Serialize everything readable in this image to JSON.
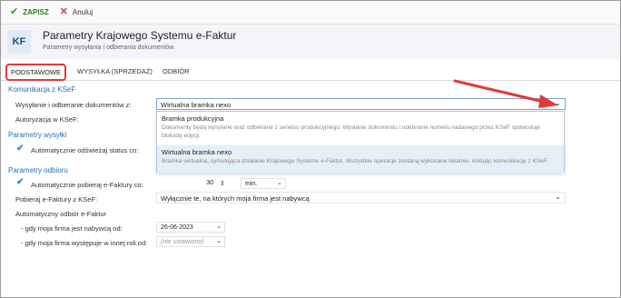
{
  "toolbar": {
    "save_label": "ZAPISZ",
    "cancel_label": "Anuluj"
  },
  "header": {
    "logo": "KF",
    "title": "Parametry Krajowego Systemu e-Faktur",
    "subtitle": "Parametry wysyłania i odbierania dokumentów."
  },
  "tabs": [
    {
      "label": "PODSTAWOWE"
    },
    {
      "label": "WYSYŁKA (SPRZEDAŻ)"
    },
    {
      "label": "ODBIÓR"
    }
  ],
  "sections": {
    "komunikacja": "Komunikacja z KSeF",
    "wysylka": "Parametry wysyłki",
    "odbior": "Parametry odbioru"
  },
  "fields": {
    "send_receive_label": "Wysyłanie i odbieranie dokumentów z:",
    "send_receive_value": "Wirtualna bramka nexo",
    "auth_label": "Autoryzacja w KSeF:",
    "auto_refresh_label": "Automatycznie odświeżaj status co:",
    "auto_fetch_label": "Automatycznie pobieraj e-Faktury co:",
    "auto_fetch_value": "30",
    "auto_fetch_unit": "min.",
    "fetch_from_label": "Pobieraj e-Faktury z KSeF:",
    "fetch_from_value": "Wyłącznie te, na których moja firma jest nabywcą",
    "auto_receive_label": "Automatyczny odbiór e-Faktur",
    "buyer_label": "- gdy moja firma jest nabywcą od:",
    "buyer_value": "26-06-2023",
    "other_label": "- gdy moja firma występuje w innej roli od:",
    "other_value": "(nie ustawiono)"
  },
  "dropdown": {
    "options": [
      {
        "name": "Bramka produkcyjna",
        "desc": "Dokumenty będą wysyłane oraz odbierane z serwisu produkcyjnego. Wysłanie dokumentu i odebranie numeru nadanego przez KSeF spowoduje blokadę edycji."
      },
      {
        "name": "Wirtualna bramka nexo",
        "desc": "Bramka wirtualna, symulująca działanie Krajowego Systemu e-Faktur. Wszystkie operacje zostaną wykonane lokalnie, imitując komunikację z KSeF."
      }
    ]
  },
  "colors": {
    "accent": "#2a6fb8",
    "annotation": "#e03a3a",
    "highlight": "#e3f0fa"
  },
  "icons": {
    "save": "check-icon",
    "cancel": "x-icon",
    "chevron": "chevron-down-icon",
    "checkbox": "checkmark-icon"
  }
}
